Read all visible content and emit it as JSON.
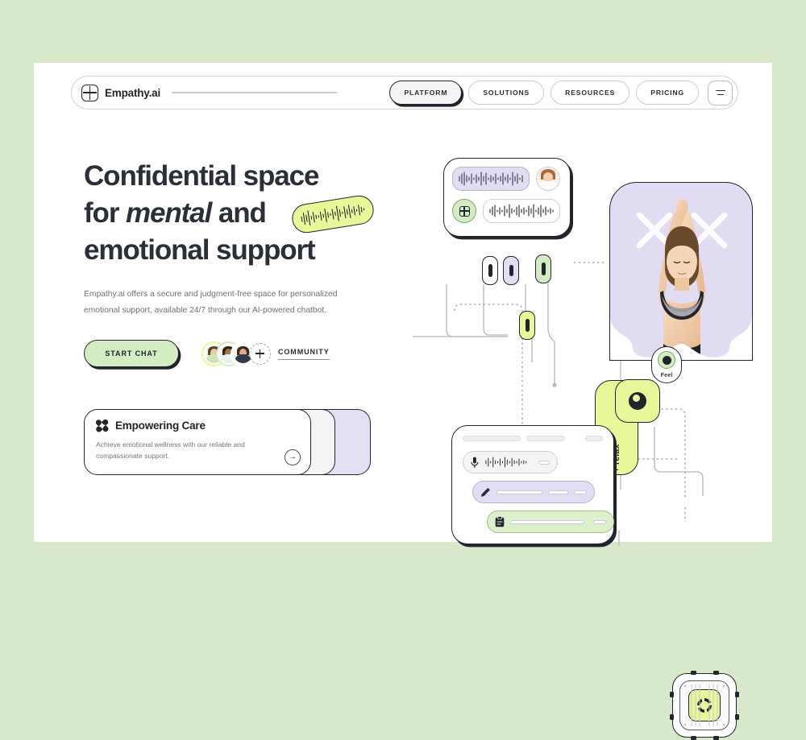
{
  "theme": {
    "page_bg": "#d8e9cb",
    "card_bg": "#ffffff",
    "ink": "#23252d",
    "accent_lime": "#e8f79a",
    "accent_green": "#d4ecc4",
    "accent_purple": "#e2ddf3",
    "muted_text": "#6c7079"
  },
  "nav": {
    "brand": "Empathy.ai",
    "logo_icon": "grid-square-logo",
    "links": [
      {
        "label": "PLATFORM",
        "active": true
      },
      {
        "label": "SOLUTIONS",
        "active": false
      },
      {
        "label": "RESOURCES",
        "active": false
      },
      {
        "label": "PRICING",
        "active": false
      }
    ],
    "menu_icon": "hamburger-menu-icon"
  },
  "hero": {
    "headline_line1": "Confidential space",
    "headline_line2_a": "for ",
    "headline_line2_em": "mental",
    "headline_line2_b": " and",
    "headline_line3": "emotional support",
    "highlight_icon": "audio-waveform-icon",
    "subtitle": "Empathy.ai offers a secure and judgment-free space for personalized emotional support, available 24/7 through our AI-powered chatbot.",
    "cta_label": "START CHAT",
    "community_label": "COMMUNITY",
    "community_add_icon": "plus-icon",
    "avatar_count": 3
  },
  "care_card": {
    "icon": "clover-icon",
    "title": "Empowering Care",
    "body": "Achieve emotional wellness with our reliable and compassionate support.",
    "arrow_icon": "arrow-right-icon",
    "stack": [
      {
        "icon": "grid-hash-icon",
        "arrow_icon": "arrow-up-right-icon",
        "color": "#f4f4f5"
      },
      {
        "icon": "pinwheel-icon",
        "arrow_icon": "arrow-up-right-icon",
        "color": "#e4e0f4"
      }
    ]
  },
  "illustration": {
    "voice_card": {
      "name": "voice-message-card",
      "waveform_icon": "audio-waveform-icon",
      "avatar_icon": "user-avatar",
      "grid_icon": "grid-square-icon"
    },
    "relax_tag": {
      "label": "+ relax",
      "icon": "eye-icon"
    },
    "hero_photo": {
      "alt": "woman-yoga-pose",
      "decor_icon": "x-cross-pattern"
    },
    "feel_node": {
      "label": "Feel",
      "icon": "dot-circle-icon"
    },
    "chip_module": {
      "name": "processor-chip-module",
      "icon": "refresh-cycle-icon"
    },
    "chat_card": {
      "rows": [
        {
          "icon": "microphone-icon",
          "type": "voice",
          "color": "#f4f4f5"
        },
        {
          "icon": "pencil-icon",
          "type": "note",
          "color": "#e2ddf3"
        },
        {
          "icon": "clipboard-icon",
          "type": "task",
          "color": "#dcf0cd"
        }
      ]
    },
    "nodes": [
      {
        "name": "node-white",
        "color": "#ffffff"
      },
      {
        "name": "node-purple",
        "color": "#e2ddf3"
      },
      {
        "name": "node-green",
        "color": "#d4ecc4"
      },
      {
        "name": "node-lime",
        "color": "#e8f79a"
      }
    ]
  }
}
